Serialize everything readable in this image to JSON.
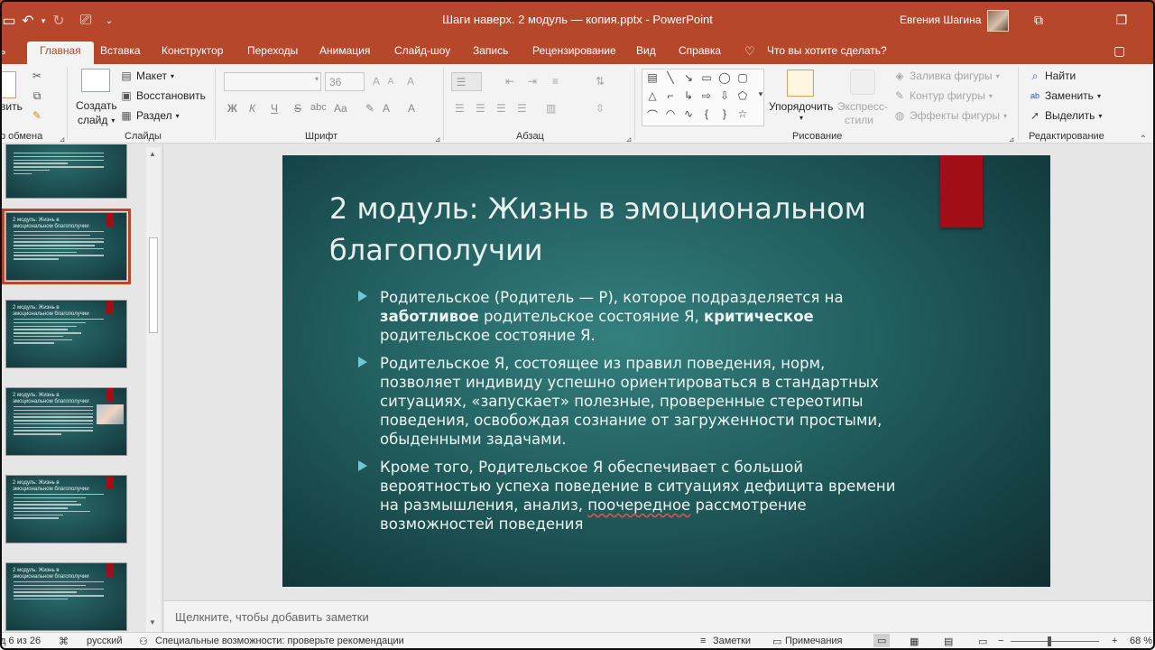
{
  "titlebar": {
    "title": "Шаги наверх. 2 модуль — копия.pptx  -  PowerPoint",
    "user": "Евгения Шагина",
    "quick_access": [
      "↶",
      "↻",
      "⎚",
      "⌄"
    ]
  },
  "tabs": [
    "Главная",
    "Вставка",
    "Конструктор",
    "Переходы",
    "Анимация",
    "Слайд-шоу",
    "Запись",
    "Рецензирование",
    "Вид",
    "Справка"
  ],
  "tell_me": "Что вы хотите сделать?",
  "ribbon": {
    "clipboard": {
      "paste": "вить",
      "group": "р обмена"
    },
    "slides": {
      "new_slide": "Создать",
      "new_slide2": "слайд",
      "layout": "Макет",
      "reset": "Восстановить",
      "section": "Раздел",
      "group": "Слайды"
    },
    "font": {
      "size": "36",
      "bold": "Ж",
      "italic": "К",
      "underline": "Ч",
      "strike": "S",
      "group": "Шрифт"
    },
    "paragraph": {
      "group": "Абзац"
    },
    "drawing": {
      "arrange": "Упорядочить",
      "quick_styles": "Экспресс-",
      "quick_styles2": "стили",
      "fill": "Заливка фигуры",
      "outline": "Контур фигуры",
      "effects": "Эффекты фигуры",
      "group": "Рисование"
    },
    "editing": {
      "find": "Найти",
      "replace": "Заменить",
      "select": "Выделить",
      "group": "Редактирование"
    }
  },
  "thumbnails": [
    {
      "title": ""
    },
    {
      "title": "2 модуль: Жизнь в эмоциональном благополучии"
    },
    {
      "title": "2 модуль: Жизнь в эмоциональном благополучии"
    },
    {
      "title": "2 модуль: Жизнь в эмоциональном благополучии"
    },
    {
      "title": "2 модуль: Жизнь в эмоциональном благополучии"
    },
    {
      "title": "2 модуль: Жизнь в эмоциональном благополучии"
    }
  ],
  "slide": {
    "title": "2 модуль: Жизнь в эмоциональном благополучии",
    "b1_pre": "Родительское (Родитель — Р), которое подразделяется на ",
    "b1_bold1": "заботливое",
    "b1_mid": " родительское состояние Я, ",
    "b1_bold2": "критическое",
    "b1_post": " родительское состояние Я.",
    "b2": "Родительское Я, состоящее из правил поведения, норм, позволяет индивиду успешно ориентироваться в стандартных ситуациях, «запускает» полезные, проверенные стереотипы поведения, освобождая сознание от загруженности простыми, обыденными задачами.",
    "b3_pre": "Кроме того, Родительское Я обеспечивает с большой вероятностью успеха поведение в ситуациях дефицита времени на размышления, анализ, ",
    "b3_squiggle": "поочередное",
    "b3_post": " рассмотрение возможностей поведения"
  },
  "notes_placeholder": "Щелкните, чтобы добавить заметки",
  "status": {
    "slide": "д 6 из 26",
    "language": "русский",
    "accessibility": "Специальные возможности: проверьте рекомендации",
    "notes": "Заметки",
    "comments": "Примечания",
    "zoom": "68 %"
  },
  "colors": {
    "accent": "#b7472a",
    "slide_bg": "#1f5557",
    "slide_red": "#a20e18",
    "bullet": "#6fc7d3"
  }
}
